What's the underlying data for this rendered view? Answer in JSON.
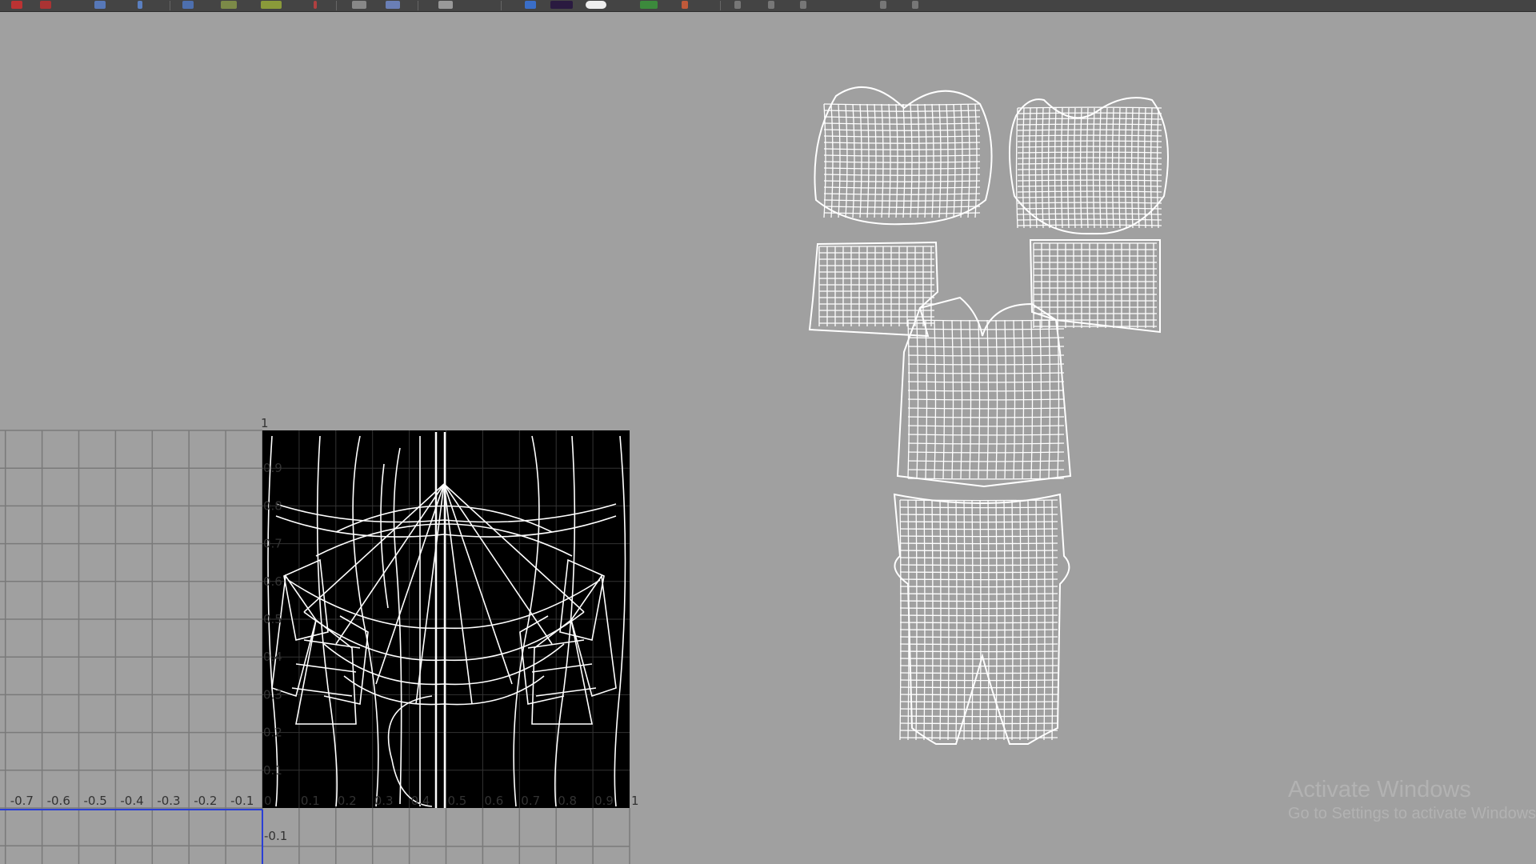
{
  "toolbar": {
    "icons": [
      "select-tool-icon",
      "move-tool-icon",
      "uv-snapshot-icon",
      "layout-icon",
      "cut-uv-icon",
      "sew-uv-icon",
      "split-icon",
      "grid-icon",
      "display-image-icon",
      "checker-icon",
      "shaded-icon",
      "color-icon",
      "uv-dist-icon",
      "render-icon",
      "pin-icon",
      "frame-icon",
      "isolate-icon"
    ]
  },
  "uv_grid": {
    "top_value_label": "1",
    "u_labels_negative": [
      "-0.7",
      "-0.6",
      "-0.5",
      "-0.4",
      "-0.3",
      "-0.2",
      "-0.1"
    ],
    "u_labels_positive": [
      "0",
      "0.1",
      "0.2",
      "0.3",
      "0.4",
      "0.5",
      "0.6",
      "0.7",
      "0.8",
      "0.9",
      "1"
    ],
    "v_labels": [
      "0.9",
      "0.8",
      "0.7",
      "0.6",
      "0.5",
      "0.4",
      "0.3",
      "0.2",
      "0.1"
    ],
    "v_below_label": "-0.1"
  },
  "colors": {
    "viewport_bg": "#a0a0a0",
    "grid_line": "#7a7a7a",
    "uv_wire": "#ffffff",
    "texture_bg": "#000000",
    "axis_blue": "#2a3fd6"
  },
  "watermark": {
    "title": "Activate Windows",
    "subtitle": "Go to Settings to activate Windows."
  }
}
